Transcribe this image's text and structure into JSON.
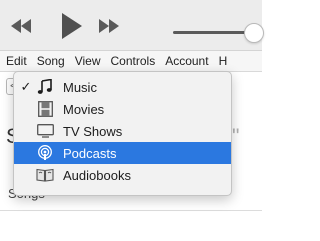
{
  "toolbar": {
    "rewind_icon": "rewind-icon",
    "play_icon": "play-icon",
    "fastforward_icon": "fast-forward-icon"
  },
  "menubar": {
    "items": [
      "Edit",
      "Song",
      "View",
      "Controls",
      "Account",
      "H"
    ]
  },
  "nav": {
    "back": "<",
    "forward": ">"
  },
  "main": {
    "heading": "Sh",
    "heading_tail": "\"",
    "songs_label": "Songs"
  },
  "media_menu": {
    "selected_color": "#2b78e0",
    "items": [
      {
        "label": "Music",
        "icon": "music-note-icon",
        "checked": true,
        "check_mark": "✓"
      },
      {
        "label": "Movies",
        "icon": "film-icon",
        "checked": false
      },
      {
        "label": "TV Shows",
        "icon": "tv-icon",
        "checked": false
      },
      {
        "label": "Podcasts",
        "icon": "podcast-icon",
        "checked": false,
        "highlighted": true
      },
      {
        "label": "Audiobooks",
        "icon": "audiobook-icon",
        "checked": false
      }
    ]
  }
}
